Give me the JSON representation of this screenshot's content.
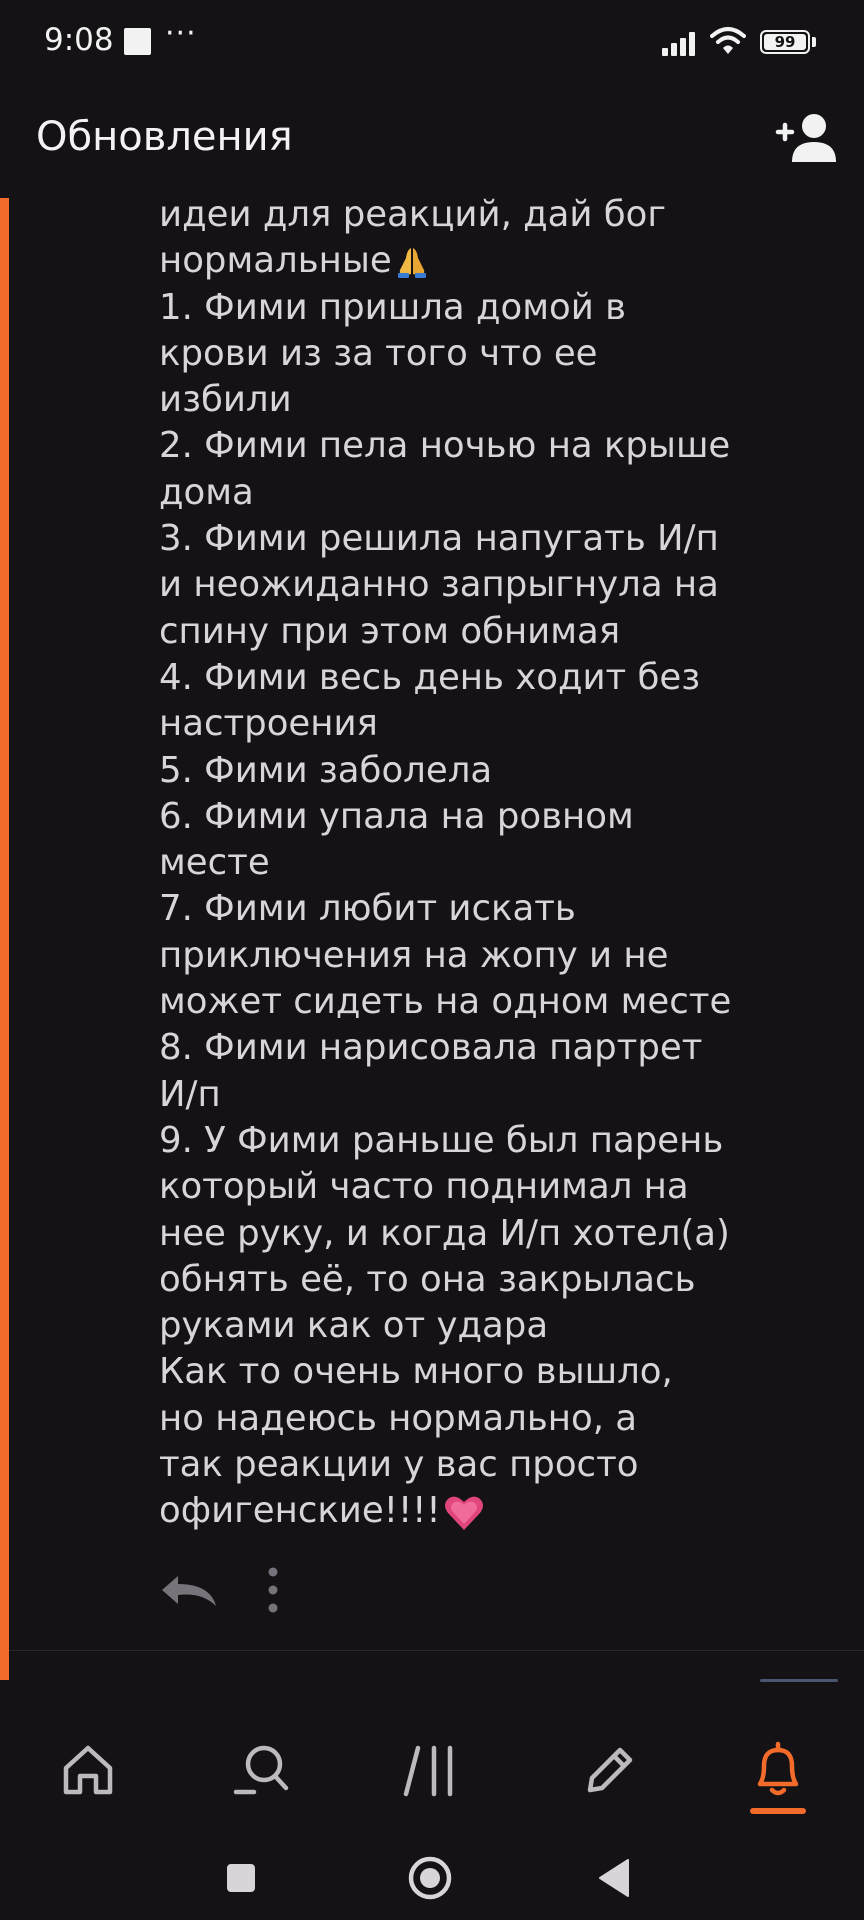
{
  "status_bar": {
    "time": "9:08",
    "more": "···",
    "battery": "99"
  },
  "header": {
    "title": "Обновления",
    "add_user_icon": "add-user-icon"
  },
  "message": {
    "lines": [
      "идеи для реакций, дай бог",
      "нормальные",
      "1. Фими пришла домой в",
      "крови из за того что ее",
      "избили",
      "2. Фими пела ночью на крыше",
      "дома",
      "3. Фими решила напугать И/п",
      "и неожиданно запрыгнула на",
      "спину при этом обнимая",
      "4. Фими весь день ходит без",
      "настроения",
      "5. Фими заболела",
      "6. Фими упала на ровном",
      "месте",
      "7. Фими любит искать",
      "приключения на жопу и не",
      "может сидеть на одном месте",
      "8. Фими нарисовала партрет",
      "И/п",
      "9. У Фими раньше был парень",
      "который часто поднимал на",
      "нее руку, и когда И/п хотел(а)",
      "обнять её, то она закрылась",
      "руками как от удара",
      "Как то очень много вышло,",
      "но надеюсь нормально, а",
      "так реакции у вас просто",
      "офигенские!!!!"
    ],
    "emojis": {
      "prayer": "folded-hands-emoji",
      "heart": "growing-heart-emoji"
    }
  },
  "actions": {
    "reply_icon": "reply-icon",
    "more_icon": "more-vertical-icon"
  },
  "tabbar": {
    "items": [
      "home-icon",
      "search-icon",
      "feed-icon",
      "edit-icon",
      "bell-icon"
    ],
    "active": "bell-icon",
    "accent_color": "#f26b2b"
  },
  "navbar": {
    "items": [
      "recents-square-icon",
      "home-circle-icon",
      "back-triangle-icon"
    ]
  }
}
